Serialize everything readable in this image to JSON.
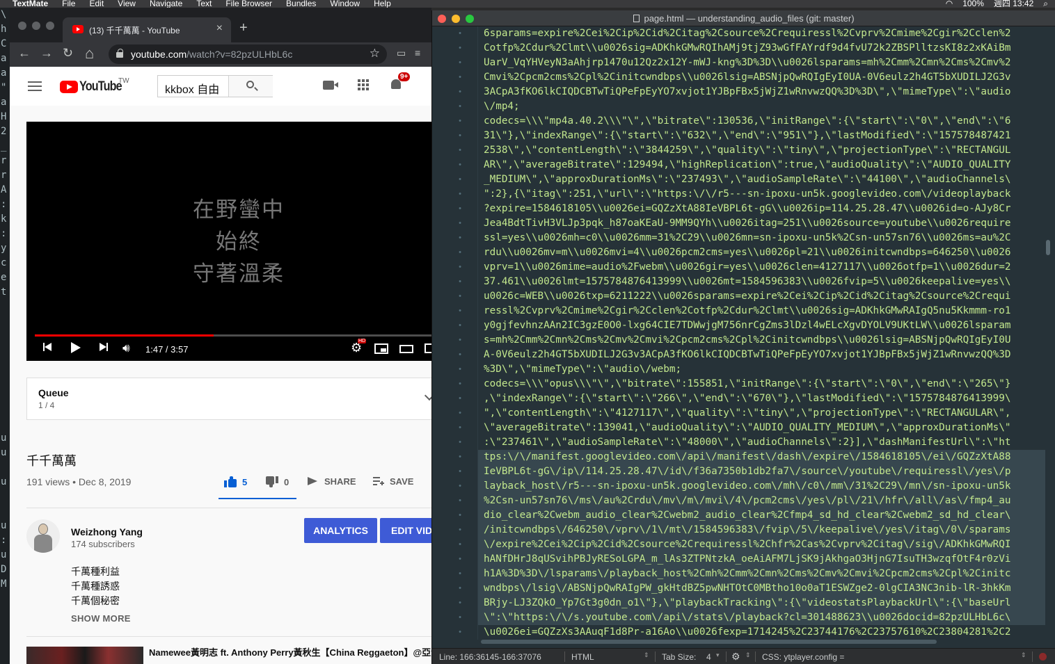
{
  "menubar": {
    "app": "TextMate",
    "items": [
      "File",
      "Edit",
      "View",
      "Navigate",
      "Text",
      "File Browser",
      "Bundles",
      "Window",
      "Help"
    ],
    "battery": "100%",
    "clock": "週四 13:42"
  },
  "background_terminal": {
    "chars": [
      "\\",
      "h",
      "C",
      "a",
      "a",
      "\"",
      "a",
      "H",
      "2",
      "_",
      "r",
      "r",
      "A",
      ":",
      "k",
      ":",
      "y",
      "c",
      "e",
      "t",
      "",
      "",
      "",
      "",
      "",
      "",
      "",
      "",
      "",
      "u",
      "u",
      "",
      "u",
      "",
      "",
      "u",
      ":",
      "u",
      "D",
      "M"
    ]
  },
  "chrome": {
    "tab": {
      "title": "(13) 千千萬萬 - YouTube",
      "close": "×"
    },
    "new_tab": "+",
    "nav": {
      "back": "←",
      "forward": "→",
      "reload": "↻",
      "home": "⌂"
    },
    "omnibox": {
      "host": "youtube.com",
      "path": "/watch?v=82pzULHbL6c"
    },
    "star": "☆"
  },
  "youtube": {
    "logo_text": "YouTube",
    "country": "TW",
    "search_query": "kkbox 自由",
    "notification_count": "9+",
    "player": {
      "lyrics": [
        "在野蠻中",
        "始終",
        "守著溫柔"
      ],
      "time": "1:47 / 3:57",
      "progress": 0.45,
      "hd_badge": "HD"
    },
    "queue": {
      "title": "Queue",
      "position": "1 / 4"
    },
    "video_title": "千千萬萬",
    "views_date": "191 views • Dec 8, 2019",
    "likes": "5",
    "dislikes": "0",
    "share_label": "SHARE",
    "save_label": "SAVE",
    "channel": {
      "name": "Weizhong Yang",
      "subscribers": "174 subscribers"
    },
    "analytics_button": "ANALYTICS",
    "edit_button": "EDIT VIDEO",
    "description": [
      "千萬種利益",
      "千萬種誘惑",
      "千萬個秘密"
    ],
    "show_more": "SHOW MORE",
    "related_title": "Namewee黃明志 ft. Anthony Perry黃秋生【China Reggaeton】@亞洲通才 Asian Polymath"
  },
  "textmate": {
    "title": "page.html — understanding_audio_files (git: master)",
    "code_lines": [
      "6sparams=expire%2Cei%2Cip%2Cid%2Citag%2Csource%2Crequiressl%2Cvprv%2Cmime%2Cgir%2Cclen%2",
      "Cotfp%2Cdur%2Clmt\\\\u0026sig=ADKhkGMwRQIhAMj9tjZ93wGfFAYrdf9d4fvU72k2ZBSPlltzsKI8z2xKAiBm",
      "UarV_VqYHVeyN3aAhjrp1470u12Qz2x12Y-mWJ-kng%3D%3D\\\\u0026lsparams=mh%2Cmm%2Cmn%2Cms%2Cmv%2",
      "Cmvi%2Cpcm2cms%2Cpl%2Cinitcwndbps\\\\u0026lsig=ABSNjpQwRQIgEyI0UA-0V6eulz2h4GT5bXUDILJ2G3v",
      "3ACpA3fKO6lkCIQDCBTwTiQPeFpEyYO7xvjot1YJBpFBx5jWjZ1wRnvwzQQ%3D%3D\\\",\\\"mimeType\\\":\\\"audio",
      "\\/mp4;",
      "codecs=\\\\\\\"mp4a.40.2\\\\\\\"\\\",\\\"bitrate\\\":130536,\\\"initRange\\\":{\\\"start\\\":\\\"0\\\",\\\"end\\\":\\\"6",
      "31\\\"},\\\"indexRange\\\":{\\\"start\\\":\\\"632\\\",\\\"end\\\":\\\"951\\\"},\\\"lastModified\\\":\\\"157578487421",
      "2538\\\",\\\"contentLength\\\":\\\"3844259\\\",\\\"quality\\\":\\\"tiny\\\",\\\"projectionType\\\":\\\"RECTANGUL",
      "AR\\\",\\\"averageBitrate\\\":129494,\\\"highReplication\\\":true,\\\"audioQuality\\\":\\\"AUDIO_QUALITY",
      "_MEDIUM\\\",\\\"approxDurationMs\\\":\\\"237493\\\",\\\"audioSampleRate\\\":\\\"44100\\\",\\\"audioChannels\\",
      "\":2},{\\\"itag\\\":251,\\\"url\\\":\\\"https:\\/\\/r5---sn-ipoxu-un5k.googlevideo.com\\/videoplayback",
      "?expire=1584618105\\\\u0026ei=GQZzXtA88IeVBPL6t-gG\\\\u0026ip=114.25.28.47\\\\u0026id=o-AJy8Cr",
      "Jea4BdtTivH3VLJp3pqk_h87oaKEaU-9MM9QYh\\\\u0026itag=251\\\\u0026source=youtube\\\\u0026require",
      "ssl=yes\\\\u0026mh=c0\\\\u0026mm=31%2C29\\\\u0026mn=sn-ipoxu-un5k%2Csn-un57sn76\\\\u0026ms=au%2C",
      "rdu\\\\u0026mv=m\\\\u0026mvi=4\\\\u0026pcm2cms=yes\\\\u0026pl=21\\\\u0026initcwndbps=646250\\\\u0026",
      "vprv=1\\\\u0026mime=audio%2Fwebm\\\\u0026gir=yes\\\\u0026clen=4127117\\\\u0026otfp=1\\\\u0026dur=2",
      "37.461\\\\u0026lmt=1575784876413999\\\\u0026mt=1584596383\\\\u0026fvip=5\\\\u0026keepalive=yes\\\\",
      "u0026c=WEB\\\\u0026txp=6211222\\\\u0026sparams=expire%2Cei%2Cip%2Cid%2Citag%2Csource%2Crequi",
      "ressl%2Cvprv%2Cmime%2Cgir%2Cclen%2Cotfp%2Cdur%2Clmt\\\\u0026sig=ADKhkGMwRAIgQ5nu5Kkmmm-ro1",
      "y0gjfevhnzAAn2IC3gzE0O0-lxg64CIE7TDWwjgM756nrCgZms3lDzl4wELcXgvDYOLV9UKtLW\\\\u0026lsparam",
      "s=mh%2Cmm%2Cmn%2Cms%2Cmv%2Cmvi%2Cpcm2cms%2Cpl%2Cinitcwndbps\\\\u0026lsig=ABSNjpQwRQIgEyI0U",
      "A-0V6eulz2h4GT5bXUDILJ2G3v3ACpA3fKO6lkCIQDCBTwTiQPeFpEyYO7xvjot1YJBpFBx5jWjZ1wRnvwzQQ%3D",
      "%3D\\\",\\\"mimeType\\\":\\\"audio\\/webm;",
      "codecs=\\\\\\\"opus\\\\\\\"\\\",\\\"bitrate\\\":155851,\\\"initRange\\\":{\\\"start\\\":\\\"0\\\",\\\"end\\\":\\\"265\\\"}",
      ",\\\"indexRange\\\":{\\\"start\\\":\\\"266\\\",\\\"end\\\":\\\"670\\\"},\\\"lastModified\\\":\\\"1575784876413999\\",
      "\",\\\"contentLength\\\":\\\"4127117\\\",\\\"quality\\\":\\\"tiny\\\",\\\"projectionType\\\":\\\"RECTANGULAR\\\",",
      "\\\"averageBitrate\\\":139041,\\\"audioQuality\\\":\\\"AUDIO_QUALITY_MEDIUM\\\",\\\"approxDurationMs\\\"",
      ":\\\"237461\\\",\\\"audioSampleRate\\\":\\\"48000\\\",\\\"audioChannels\\\":2}],\\\"dashManifestUrl\\\":\\\"ht",
      "tps:\\/\\/manifest.googlevideo.com\\/api\\/manifest\\/dash\\/expire\\/1584618105\\/ei\\/GQZzXtA88",
      "IeVBPL6t-gG\\/ip\\/114.25.28.47\\/id\\/f36a7350b1db2fa7\\/source\\/youtube\\/requiressl\\/yes\\/p",
      "layback_host\\/r5---sn-ipoxu-un5k.googlevideo.com\\/mh\\/c0\\/mm\\/31%2C29\\/mn\\/sn-ipoxu-un5k",
      "%2Csn-un57sn76\\/ms\\/au%2Crdu\\/mv\\/m\\/mvi\\/4\\/pcm2cms\\/yes\\/pl\\/21\\/hfr\\/all\\/as\\/fmp4_au",
      "dio_clear%2Cwebm_audio_clear%2Cwebm2_audio_clear%2Cfmp4_sd_hd_clear%2Cwebm2_sd_hd_clear\\",
      "/initcwndbps\\/646250\\/vprv\\/1\\/mt\\/1584596383\\/fvip\\/5\\/keepalive\\/yes\\/itag\\/0\\/sparams",
      "\\/expire%2Cei%2Cip%2Cid%2Csource%2Crequiressl%2Chfr%2Cas%2Cvprv%2Citag\\/sig\\/ADKhkGMwRQI",
      "hANfDHrJ8qUSvihPBJyRESoLGPA_m_lAs3ZTPNtzkA_oeAiAFM7LjSK9jAkhgaO3HjnG7IsuTH3wzqfOtF4r0zVi",
      "h1A%3D%3D\\/lsparams\\/playback_host%2Cmh%2Cmm%2Cmn%2Cms%2Cmv%2Cmvi%2Cpcm2cms%2Cpl%2Cinitc",
      "wndbps\\/lsig\\/ABSNjpQwRAIgPW_gkHtdBZ5pwNHTOtC0MBtho10o0aT1ESWZge2-0lgCIA3NC3nib-lR-3hkKm",
      "BRjy-LJ3ZQkO_Yp7Gt3g0dn_o1\\\"},\\\"playbackTracking\\\":{\\\"videostatsPlaybackUrl\\\":{\\\"baseUrl",
      "\\\":\\\"https:\\/\\/s.youtube.com\\/api\\/stats\\/playback?cl=301488623\\\\u0026docid=82pzULHbL6c\\",
      "\\u0026ei=GQZzXs3AAuqF1d8Pr-a16Ao\\\\u0026fexp=1714245%2C23744176%2C23757610%2C23804281%2C2"
    ],
    "gutter_marks": [
      "•",
      "•",
      "•",
      "•",
      "•",
      "•",
      "•",
      "•",
      "•",
      "•",
      "•",
      "•",
      "•",
      "•",
      "•",
      "•",
      "•",
      "•",
      "•",
      "•",
      "•",
      "•",
      "•",
      "•",
      "•",
      "•",
      "•",
      "•",
      "•",
      "•",
      "•",
      "•",
      "•",
      "•",
      "•",
      "•",
      "•",
      "•",
      "•",
      "•",
      "•",
      "•"
    ],
    "status": {
      "line": "Line:  166:36145-166:37076",
      "syntax": "HTML",
      "tab_size_label": "Tab Size:",
      "tab_size": "4",
      "scope": "CSS: ytplayer.config ="
    }
  }
}
